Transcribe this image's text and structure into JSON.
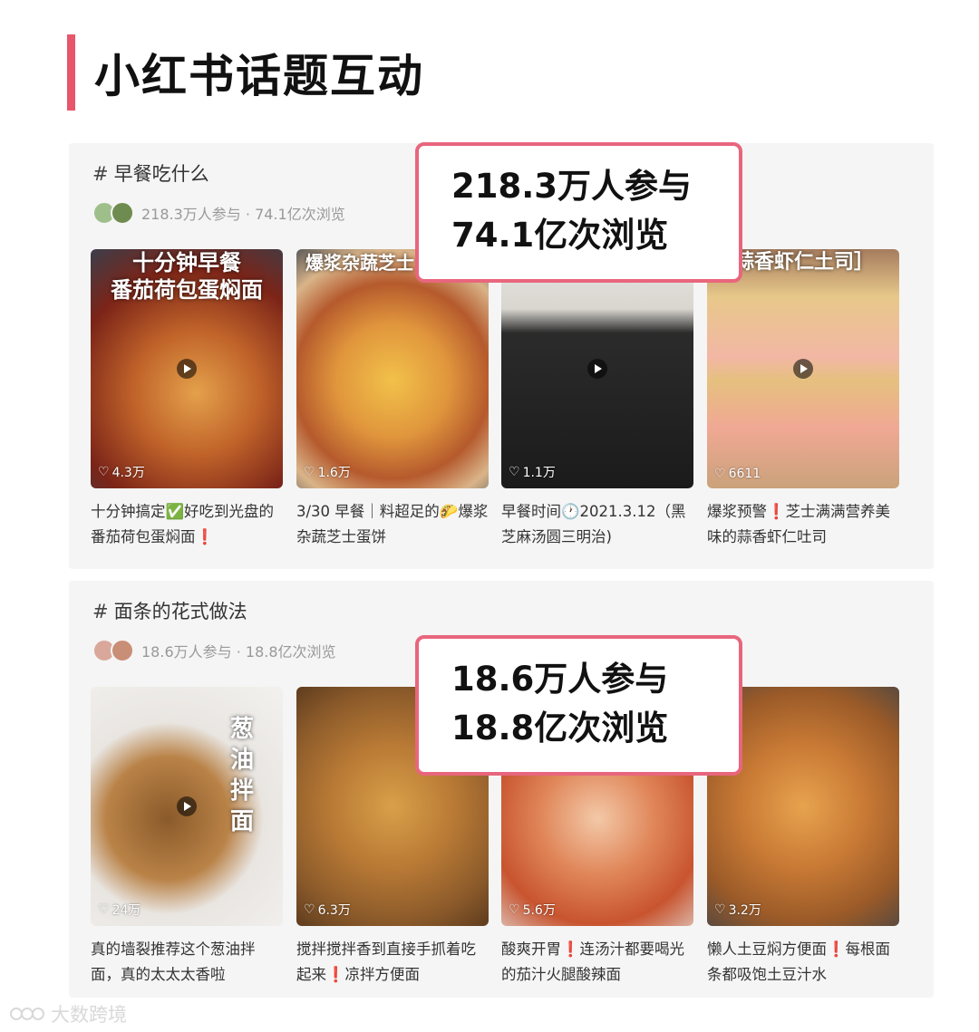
{
  "page_title": "小红书话题互动",
  "topics": [
    {
      "name": "早餐吃什么",
      "meta": "218.3万人参与 · 74.1亿次浏览",
      "callout": [
        "218.3万人参与",
        "74.1亿次浏览"
      ],
      "cards": [
        {
          "overlay_l1": "十分钟早餐",
          "overlay_l2": "番茄荷包蛋焖面",
          "likes": "4.3万",
          "caption": "十分钟搞定✅好吃到光盘的番茄荷包蛋焖面❗"
        },
        {
          "overlay_l1": "爆浆杂蔬芝士",
          "overlay_l2": "",
          "likes": "1.6万",
          "caption": "3/30 早餐｜料超足的🌮爆浆杂蔬芝士蛋饼"
        },
        {
          "overlay_l1": "",
          "overlay_l2": "",
          "likes": "1.1万",
          "caption": "早餐时间🕐2021.3.12（黑芝麻汤圆三明治)"
        },
        {
          "overlay_l1": "蒜香虾仁土司］",
          "overlay_l2": "",
          "likes": "6611",
          "caption": "爆浆预警❗芝士满满营养美味的蒜香虾仁吐司"
        }
      ]
    },
    {
      "name": "面条的花式做法",
      "meta": "18.6万人参与 · 18.8亿次浏览",
      "callout": [
        "18.6万人参与",
        "18.8亿次浏览"
      ],
      "cards": [
        {
          "overlay_l1": "葱油拌面",
          "overlay_l2": "",
          "likes": "24万",
          "caption": "真的墙裂推荐这个葱油拌面，真的太太太香啦"
        },
        {
          "overlay_l1": "",
          "overlay_l2": "",
          "likes": "6.3万",
          "caption": "搅拌搅拌香到直接手抓着吃起来❗凉拌方便面"
        },
        {
          "overlay_l1": "",
          "overlay_l2": "",
          "likes": "5.6万",
          "caption": "酸爽开胃❗连汤汁都要喝光的茄汁火腿酸辣面"
        },
        {
          "overlay_l1": "",
          "overlay_l2": "",
          "likes": "3.2万",
          "caption": "懒人土豆焖方便面❗每根面条都吸饱土豆汁水"
        }
      ]
    }
  ],
  "watermark": "大数跨境",
  "colors": {
    "accent": "#e8566b",
    "callout_border": "#e8667d"
  }
}
